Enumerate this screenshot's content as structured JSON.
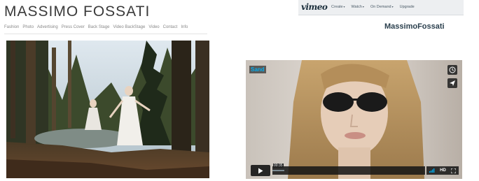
{
  "site": {
    "title": "MASSIMO FOSSATI",
    "nav": [
      "Fashion",
      "Photo",
      "Advertising",
      "Press Cover",
      "Back Stage",
      "Video BackStage",
      "Video",
      "Contact",
      "Info"
    ]
  },
  "vimeo": {
    "logo": "vimeo",
    "menu": [
      {
        "label": "Create"
      },
      {
        "label": "Watch"
      },
      {
        "label": "On Demand"
      },
      {
        "label": "Upgrade"
      }
    ],
    "caret_glyph": "▾",
    "user_name": "MassimoFossati",
    "player": {
      "badge": "Sand",
      "time": "00:35",
      "hd_label": "HD",
      "progress": 0.08
    }
  },
  "colors": {
    "vimeo_blue": "#00adef",
    "title_gray": "#3a3a3a"
  }
}
